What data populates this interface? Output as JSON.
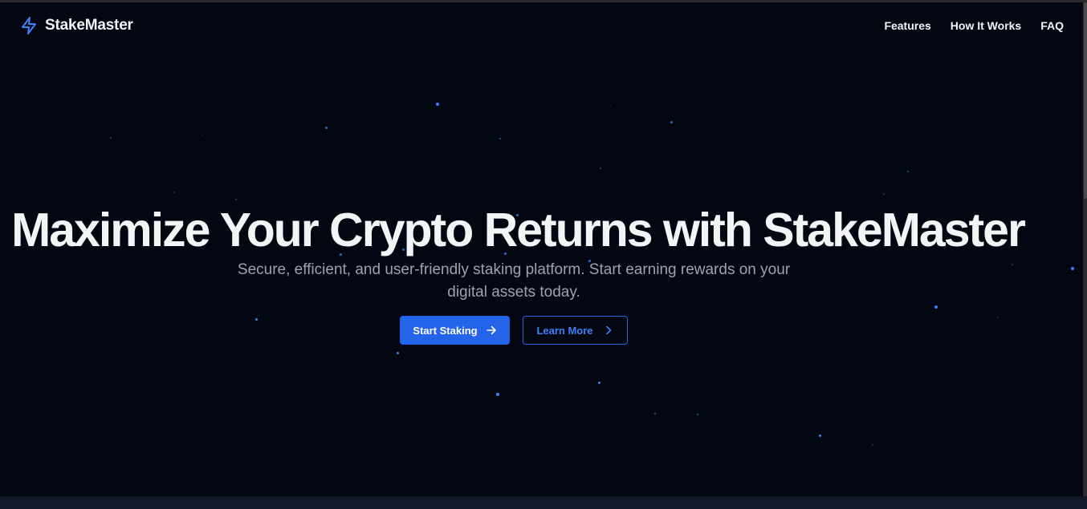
{
  "brand": {
    "name": "StakeMaster",
    "icon": "lightning-bolt-icon",
    "accent_color": "#3b82f6"
  },
  "nav": {
    "links": [
      {
        "label": "Features"
      },
      {
        "label": "How It Works"
      },
      {
        "label": "FAQ"
      }
    ]
  },
  "hero": {
    "title": "Maximize Your Crypto Returns with StakeMaster",
    "subtitle": "Secure, efficient, and user-friendly staking platform. Start earning rewards on your digital assets today.",
    "primary_button": {
      "label": "Start Staking",
      "icon": "arrow-right-icon"
    },
    "secondary_button": {
      "label": "Learn More",
      "icon": "chevron-right-icon"
    }
  },
  "theme": {
    "background": "#030712",
    "primary": "#2563eb",
    "star_color": "#3b82f6",
    "text": "#f3f4f6",
    "muted_text": "#9ca3af"
  }
}
